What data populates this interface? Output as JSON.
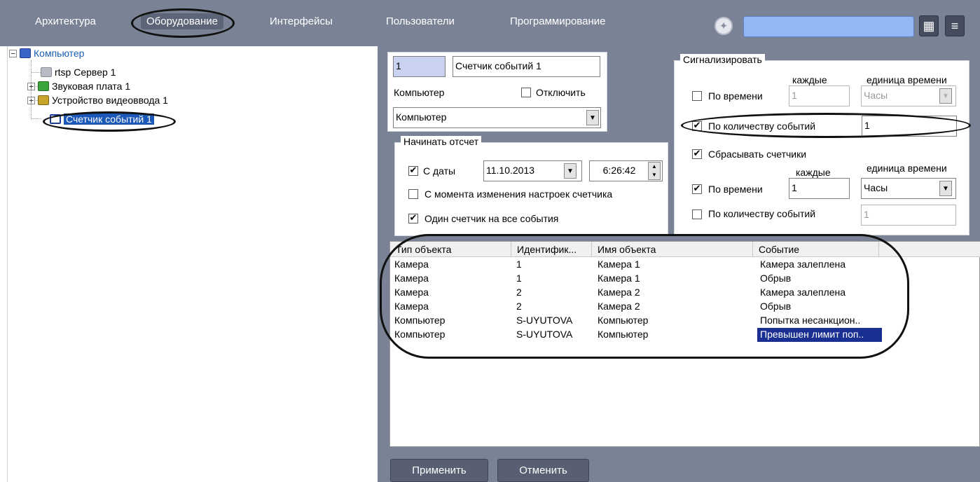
{
  "topbar": {
    "tabs": [
      "Архитектура",
      "Оборудование",
      "Интерфейсы",
      "Пользователи",
      "Программирование"
    ],
    "active_tab": "Оборудование"
  },
  "tree": {
    "root": "Компьютер",
    "children": [
      "rtsp Сервер 1",
      "Звуковая плата 1",
      "Устройство видеоввода 1",
      "Счетчик событий 1"
    ],
    "selected": "Счетчик событий 1"
  },
  "object": {
    "id": "1",
    "name": "Счетчик событий 1",
    "computer_label": "Компьютер",
    "disable_label": "Отключить",
    "disable_checked": false,
    "computer_value": "Компьютер"
  },
  "start": {
    "title": "Начинать отсчет",
    "from_date_label": "С даты",
    "from_date_checked": true,
    "date": "11.10.2013",
    "time": "6:26:42",
    "on_change_label": "С момента изменения настроек счетчика",
    "on_change_checked": false,
    "single_counter_label": "Один счетчик на все события",
    "single_counter_checked": true
  },
  "signal": {
    "title": "Сигнализировать",
    "every_label": "каждые",
    "unit_label": "единица времени",
    "by_time_label": "По времени",
    "by_time_checked": false,
    "by_time_value": "1",
    "by_time_unit": "Часы",
    "by_count_label": "По количеству событий",
    "by_count_checked": true,
    "by_count_value": "1"
  },
  "reset": {
    "label": "Сбрасывать счетчики",
    "checked": true,
    "every_label": "каждые",
    "unit_label": "единица времени",
    "by_time_label": "По времени",
    "by_time_checked": true,
    "by_time_value": "1",
    "by_time_unit": "Часы",
    "by_count_label": "По количеству событий",
    "by_count_checked": false,
    "by_count_value": "1"
  },
  "table": {
    "columns": [
      "Тип объекта",
      "Идентифик...",
      "Имя объекта",
      "Событие"
    ],
    "rows": [
      [
        "Камера",
        "1",
        "Камера 1",
        "Камера залеплена"
      ],
      [
        "Камера",
        "1",
        "Камера 1",
        "Обрыв"
      ],
      [
        "Камера",
        "2",
        "Камера 2",
        "Камера залеплена"
      ],
      [
        "Камера",
        "2",
        "Камера 2",
        "Обрыв"
      ],
      [
        "Компьютер",
        "S-UYUTOVA",
        "Компьютер",
        "Попытка несанкцион.."
      ],
      [
        "Компьютер",
        "S-UYUTOVA",
        "Компьютер",
        "Превышен лимит поп.."
      ]
    ],
    "selected_row": 5
  },
  "buttons": {
    "apply": "Применить",
    "cancel": "Отменить"
  },
  "colors": {
    "panel": "#7a8396",
    "search": "#93b6f4",
    "selection": "#1a2f92"
  }
}
